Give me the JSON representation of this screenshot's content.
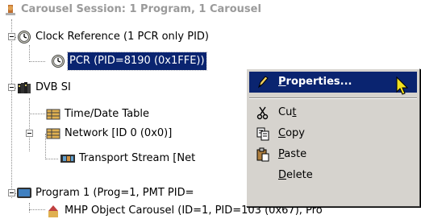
{
  "tree": {
    "root": "Carousel Session: 1 Program, 1 Carousel",
    "items": [
      {
        "label": "Clock Reference (1 PCR only PID)"
      },
      {
        "label": "PCR (PID=8190 (0x1FFE))"
      },
      {
        "label": "DVB SI"
      },
      {
        "label": "Time/Date Table"
      },
      {
        "label": "Network [ID 0 (0x0)]"
      },
      {
        "label": "Transport Stream [Net"
      },
      {
        "label": "Program 1 (Prog=1, PMT PID="
      },
      {
        "label": "MHP Object Carousel (ID=1, PID=103 (0x67), Pro"
      }
    ]
  },
  "context_menu": {
    "properties": {
      "pre": "",
      "u": "P",
      "post": "roperties..."
    },
    "cut": {
      "pre": "Cu",
      "u": "t",
      "post": ""
    },
    "copy": {
      "pre": "",
      "u": "C",
      "post": "opy"
    },
    "paste": {
      "pre": "",
      "u": "P",
      "post": "aste"
    },
    "delete": {
      "pre": "",
      "u": "D",
      "post": "elete"
    }
  },
  "colors": {
    "selection": "#0a2470",
    "menu_bg": "#d6d3ce"
  }
}
